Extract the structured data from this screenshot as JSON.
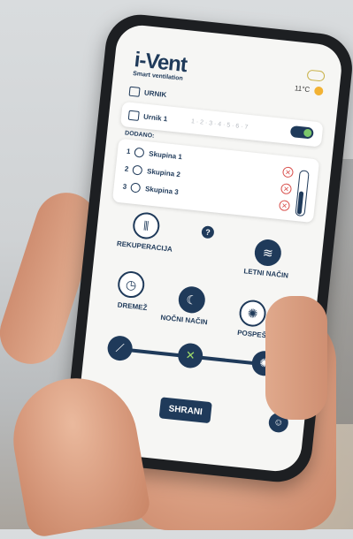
{
  "app": {
    "logo": "i-Vent",
    "logo_sub": "Smart ventilation"
  },
  "weather": {
    "temperature": "11°C",
    "icon": "cloud-sun-icon"
  },
  "schedule_label": "URNIK",
  "schedule_card": {
    "name": "Urnik 1",
    "days": "1 · 2 · 3 · 4 · 5 · 6 · 7",
    "enabled": true
  },
  "groups": {
    "title": "DODANO:",
    "items": [
      {
        "number": "1",
        "label": "Skupina 1"
      },
      {
        "number": "2",
        "label": "Skupina 2"
      },
      {
        "number": "3",
        "label": "Skupina 3"
      }
    ]
  },
  "help_label": "?",
  "modes": {
    "recuperation": "REKUPERACIJA",
    "summer": "LETNI NAČIN",
    "nap": "DREMEŽ",
    "night": "NOČNI NAČIN",
    "boost": "POSPEŠI"
  },
  "speed": {
    "levels": 3,
    "active_level": 2
  },
  "actions": {
    "save": "SHRANI",
    "back": "‹"
  },
  "colors": {
    "brand": "#1f3a5a",
    "toggle_on": "#7cc86b",
    "remove": "#d9534f"
  }
}
